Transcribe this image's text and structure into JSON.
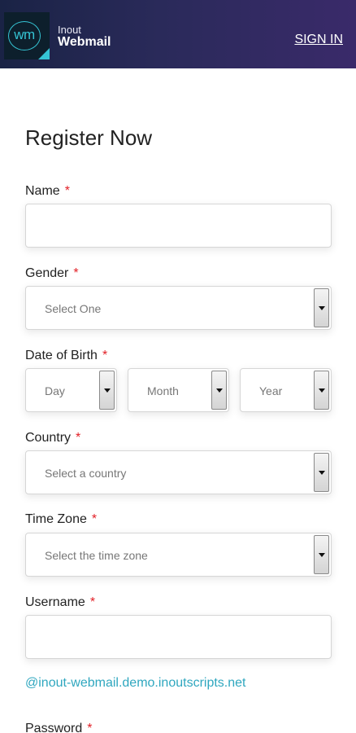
{
  "header": {
    "logo_text": "wm",
    "brand_top": "Inout",
    "brand_main": "Webmail",
    "signin": "SIGN IN"
  },
  "form": {
    "title": "Register Now",
    "required_mark": "*",
    "name_label": "Name",
    "gender_label": "Gender",
    "gender_placeholder": "Select One",
    "dob_label": "Date of Birth",
    "day_placeholder": "Day",
    "month_placeholder": "Month",
    "year_placeholder": "Year",
    "country_label": "Country",
    "country_placeholder": "Select a country",
    "timezone_label": "Time Zone",
    "timezone_placeholder": "Select the time zone",
    "username_label": "Username",
    "domain_suffix": "@inout-webmail.demo.inoutscripts.net",
    "password_label": "Password"
  },
  "colors": {
    "required": "#e21f26",
    "domain_text": "#2fa7bf",
    "logo_accent": "#35c4d4"
  }
}
